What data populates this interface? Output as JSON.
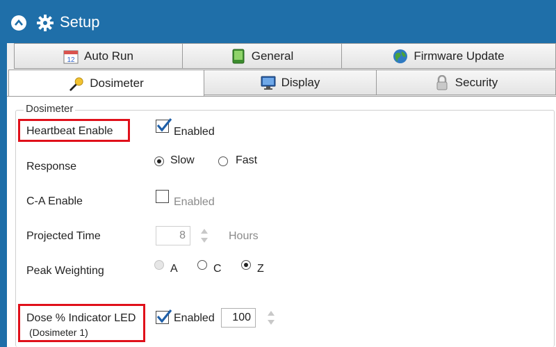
{
  "window": {
    "title": "Setup"
  },
  "tabs": {
    "row1": [
      {
        "label": "Auto Run",
        "icon": "calendar-icon"
      },
      {
        "label": "General",
        "icon": "green-device-icon"
      },
      {
        "label": "Firmware Update",
        "icon": "globe-icon"
      }
    ],
    "row2": [
      {
        "label": "Dosimeter",
        "icon": "microphone-icon",
        "active": true
      },
      {
        "label": "Display",
        "icon": "monitor-icon"
      },
      {
        "label": "Security",
        "icon": "padlock-icon"
      }
    ]
  },
  "group": {
    "label": "Dosimeter"
  },
  "settings": {
    "heartbeat": {
      "label": "Heartbeat Enable",
      "checkbox_label": "Enabled",
      "checked": true
    },
    "response": {
      "label": "Response",
      "options": [
        "Slow",
        "Fast"
      ],
      "selected": "Slow"
    },
    "ca_enable": {
      "label": "C-A Enable",
      "checkbox_label": "Enabled",
      "checked": false
    },
    "projected_time": {
      "label": "Projected Time",
      "value": "8",
      "unit": "Hours"
    },
    "peak_weighting": {
      "label": "Peak Weighting",
      "options": [
        "A",
        "C",
        "Z"
      ],
      "selected": "Z"
    },
    "dose_led": {
      "label": "Dose % Indicator LED",
      "sublabel": "(Dosimeter 1)",
      "checkbox_label": "Enabled",
      "checked": true,
      "value": "100"
    }
  },
  "colors": {
    "titlebar": "#1f6fa9",
    "highlight": "#e0101a",
    "check": "#1f5fa8"
  }
}
